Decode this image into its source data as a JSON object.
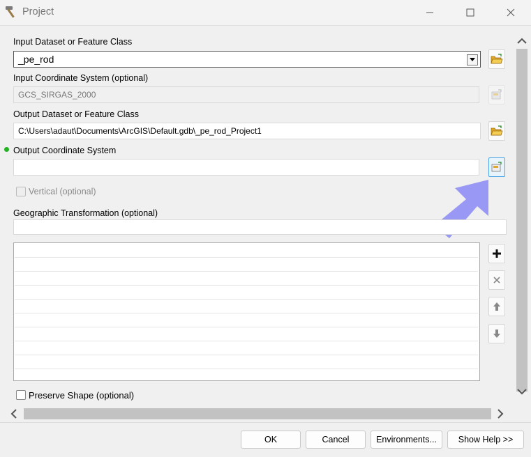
{
  "window": {
    "title": "Project",
    "controls": [
      "minimize-icon",
      "maximize-icon",
      "close-icon"
    ]
  },
  "form": {
    "input_dataset": {
      "label": "Input Dataset or Feature Class",
      "value": "_pe_rod"
    },
    "input_coord": {
      "label": "Input Coordinate System (optional)",
      "value": "GCS_SIRGAS_2000"
    },
    "output_dataset": {
      "label": "Output Dataset or Feature Class",
      "value": "C:\\Users\\adaut\\Documents\\ArcGIS\\Default.gdb\\_pe_rod_Project1"
    },
    "output_coord": {
      "label": "Output Coordinate System",
      "value": ""
    },
    "vertical": {
      "label": "Vertical (optional)",
      "checked": false,
      "enabled": false
    },
    "geo_transform": {
      "label": "Geographic Transformation (optional)",
      "value": ""
    },
    "preserve_shape": {
      "label": "Preserve Shape (optional)",
      "checked": false
    }
  },
  "list_buttons": [
    "add-icon",
    "remove-icon",
    "move-up-icon",
    "move-down-icon"
  ],
  "footer": {
    "ok": "OK",
    "cancel": "Cancel",
    "environments": "Environments...",
    "show_help": "Show Help >>"
  },
  "colors": {
    "required_dot": "#22b222",
    "annotation_arrow": "#8f8ff5",
    "selected_button_border": "#4aa3e6"
  }
}
